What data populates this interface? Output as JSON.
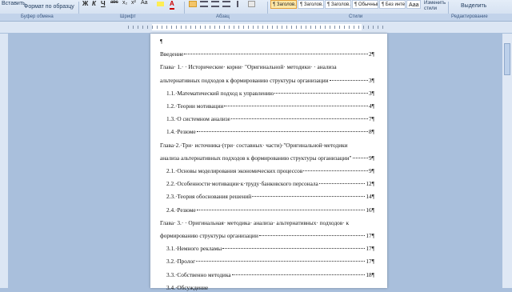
{
  "ribbon": {
    "paste_label": "Вставить",
    "format_painter": "Формат по образцу",
    "bold": "Ж",
    "italic": "К",
    "underline": "Ч",
    "strike": "abc",
    "subscript": "x₂",
    "superscript": "x²",
    "case": "Aa",
    "font_color": "A",
    "styles": [
      "¶ Заголов...",
      "¶ Заголов...",
      "¶ Заголов...",
      "¶ Обычный",
      "¶ Без инте...",
      "Ааа"
    ],
    "change_styles": "Изменить стили",
    "select": "Выделить",
    "groups": [
      "Буфер обмена",
      "Шрифт",
      "Абзац",
      "Стили",
      "Редактирование"
    ]
  },
  "document": {
    "lines": [
      {
        "text": "¶",
        "page": "",
        "indent": false
      },
      {
        "text": "Введение",
        "page": "2¶",
        "indent": false
      },
      {
        "text": "Глава· 1.· · Исторические· корни· \"Оригинальной· методики· · анализа",
        "page": "",
        "indent": false
      },
      {
        "text": "альтернативных подходов к формированию структуры организации",
        "page": "3¶",
        "indent": false
      },
      {
        "text": "1.1.·Математический подход к управлению",
        "page": "3¶",
        "indent": true
      },
      {
        "text": "1.2.·Теории мотивации",
        "page": "4¶",
        "indent": true
      },
      {
        "text": "1.3.·О системном анализе",
        "page": "7¶",
        "indent": true
      },
      {
        "text": "1.4.·Резюме",
        "page": "8¶",
        "indent": true
      },
      {
        "text": "Глава·2.·Три· источника·(три· составных· части)·\"Оригинальной·методики",
        "page": "",
        "indent": false
      },
      {
        "text": "анализа альтернативных подходов к формированию структуры организации\"",
        "page": "9¶",
        "indent": false
      },
      {
        "text": "2.1.·Основы моделирования экономических процессов",
        "page": "9¶",
        "indent": true
      },
      {
        "text": "2.2.·Особенности·мотивации·к·труду·банковского персонала",
        "page": "12¶",
        "indent": true
      },
      {
        "text": "2.3.·Теория обоснования решений",
        "page": "14¶",
        "indent": true
      },
      {
        "text": "2.4.·Резюме",
        "page": "16¶",
        "indent": true
      },
      {
        "text": "Глава· 3.· · Оригинальная· методика· анализа· альтернативных· подходов· к",
        "page": "",
        "indent": false
      },
      {
        "text": "формированию структуры организации",
        "page": "17¶",
        "indent": false
      },
      {
        "text": "3.1.·Немного рекламы",
        "page": "17¶",
        "indent": true
      },
      {
        "text": "3.2.·Пролог",
        "page": "17¶",
        "indent": true
      },
      {
        "text": "3.3.·Собственно методика",
        "page": "18¶",
        "indent": true
      },
      {
        "text": "3.4.·Обсуждение",
        "page": "",
        "indent": true
      }
    ]
  }
}
